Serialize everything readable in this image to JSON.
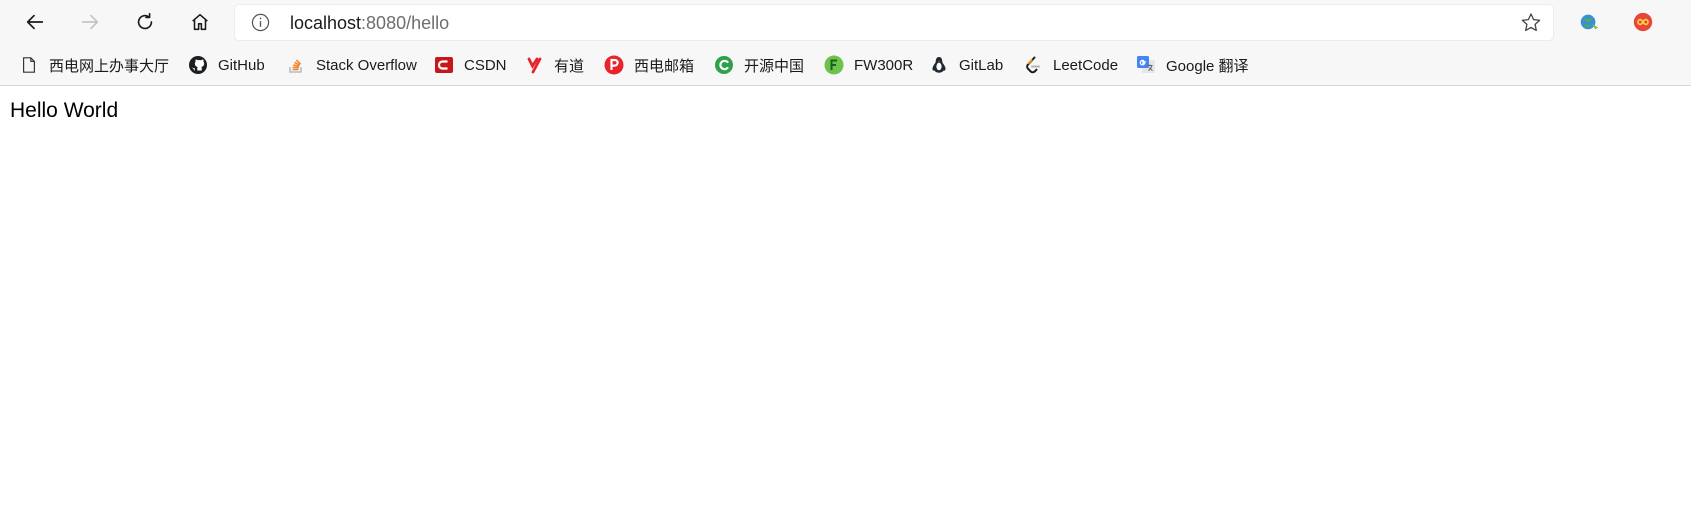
{
  "address_bar": {
    "url_host": "localhost",
    "url_rest": ":8080/hello"
  },
  "bookmarks": [
    {
      "label": "西电网上办事大厅",
      "icon": "page-icon"
    },
    {
      "label": "GitHub",
      "icon": "github-icon"
    },
    {
      "label": "Stack Overflow",
      "icon": "stackoverflow-icon"
    },
    {
      "label": "CSDN",
      "icon": "csdn-icon"
    },
    {
      "label": "有道",
      "icon": "youdao-icon"
    },
    {
      "label": "西电邮箱",
      "icon": "mail-p-icon"
    },
    {
      "label": "开源中国",
      "icon": "oschina-icon"
    },
    {
      "label": "FW300R",
      "icon": "router-f-icon"
    },
    {
      "label": "GitLab",
      "icon": "penguin-icon"
    },
    {
      "label": "LeetCode",
      "icon": "leetcode-icon"
    },
    {
      "label": "Google 翻译",
      "icon": "google-translate-icon"
    }
  ],
  "page": {
    "body_text": "Hello World"
  },
  "colors": {
    "chrome_bg": "#f7f7f7",
    "csdn_red": "#c8161d",
    "youdao_red": "#e8232b",
    "oschina_green": "#2fa14b",
    "fw300r_green": "#6cc24a",
    "extension_red": "#e8453c"
  }
}
